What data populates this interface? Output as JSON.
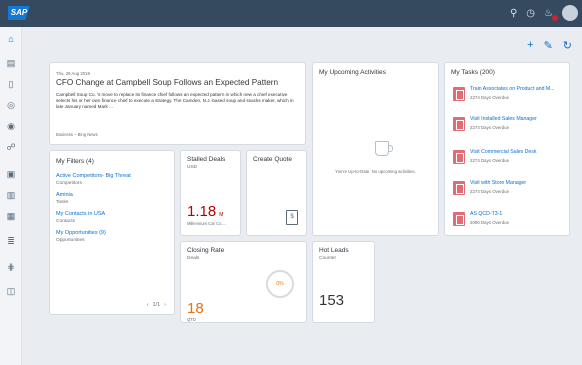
{
  "shell": {
    "logo": "SAP"
  },
  "news": {
    "date": "Thu, 29 Aug 2019",
    "headline": "CFO Change at Campbell Soup Follows an Expected Pattern",
    "body": "Campbell Soup Co. 's move to replace its finance chief follows an expected pattern in which new a chief executive selects his or her own finance chief to execute a strategy. The Camden, N.J.-based soup and snacks maker, which in late January named Mark ...",
    "source": "Business – Bing News"
  },
  "filters": {
    "title": "My Filters (4)",
    "items": [
      {
        "label": "Active Competitors- Big Threat",
        "sub": "Competitors"
      },
      {
        "label": "Aminia",
        "sub": "Tasks"
      },
      {
        "label": "My Contacts in USA",
        "sub": "Contacts"
      },
      {
        "label": "My Opportunities (9)",
        "sub": "Opportunities"
      }
    ],
    "pager": {
      "prev": "‹",
      "page": "1/1",
      "next": "›"
    }
  },
  "stalled": {
    "title": "Stalled Deals",
    "sub": "USD",
    "value": "1.18",
    "unit": "M",
    "footer": "Millennium Car Co...."
  },
  "quote": {
    "title": "Create Quote",
    "icon_text": "$"
  },
  "closing": {
    "title": "Closing Rate",
    "sub": "Deals",
    "value": "18",
    "footer": "QTD",
    "ring_label": "0%"
  },
  "leads": {
    "title": "Hot Leads",
    "sub": "Counter",
    "value": "153"
  },
  "activities": {
    "title": "My Upcoming Activities",
    "empty": "You're Up-to-Date. No upcoming activities."
  },
  "tasks": {
    "title": "My Tasks (200)",
    "items": [
      {
        "label": "Train Associates on Product and M...",
        "sub": "2274 Days Overdue"
      },
      {
        "label": "Visit Installed Sales Manager",
        "sub": "2274 Days Overdue"
      },
      {
        "label": "Visit Commercial Sales Desk",
        "sub": "2274 Days Overdue"
      },
      {
        "label": "Visit with Store Manager",
        "sub": "2274 Days Overdue"
      },
      {
        "label": "AS QCD-T3-1",
        "sub": "2090 Days Overdue"
      }
    ]
  },
  "actions": {
    "add": "+",
    "edit": "✎",
    "refresh": "↻"
  },
  "colors": {
    "shell": "#354a5f",
    "link": "#0a6ed1",
    "negative": "#bb0000",
    "critical": "#e9730c",
    "task_icon": "#e06d76"
  }
}
